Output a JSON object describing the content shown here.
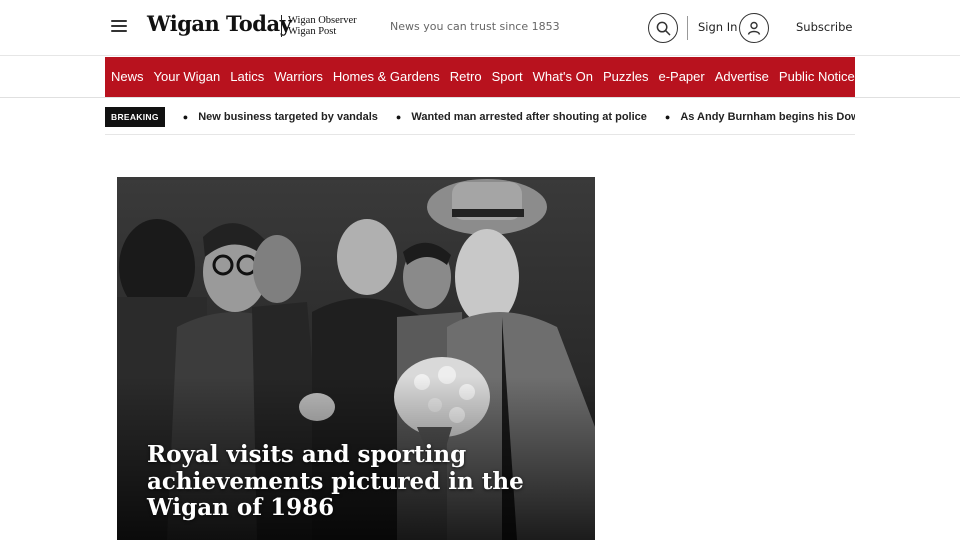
{
  "header": {
    "logo_main": "Wigan Today",
    "logo_sub_line1": "Wigan Observer",
    "logo_sub_line2": "Wigan Post",
    "tagline": "News you can trust since 1853",
    "sign_in_label": "Sign In",
    "subscribe_label": "Subscribe"
  },
  "nav": {
    "items": [
      "News",
      "Your Wigan",
      "Latics",
      "Warriors",
      "Homes & Gardens",
      "Retro",
      "Sport",
      "What's On",
      "Puzzles",
      "e-Paper",
      "Advertise",
      "Public Notices"
    ]
  },
  "breaking": {
    "badge": "BREAKING",
    "items": [
      "New business targeted by vandals",
      "Wanted man arrested after shouting at police",
      "As Andy Burnham begins his Downing Street"
    ]
  },
  "hero": {
    "headline": "Royal visits and sporting achievements pictured in the Wigan of 1986"
  },
  "colors": {
    "nav_background": "#b8121e",
    "breaking_badge": "#111111"
  },
  "icons": [
    "hamburger-menu-icon",
    "search-icon",
    "user-icon",
    "bullet-icon"
  ]
}
